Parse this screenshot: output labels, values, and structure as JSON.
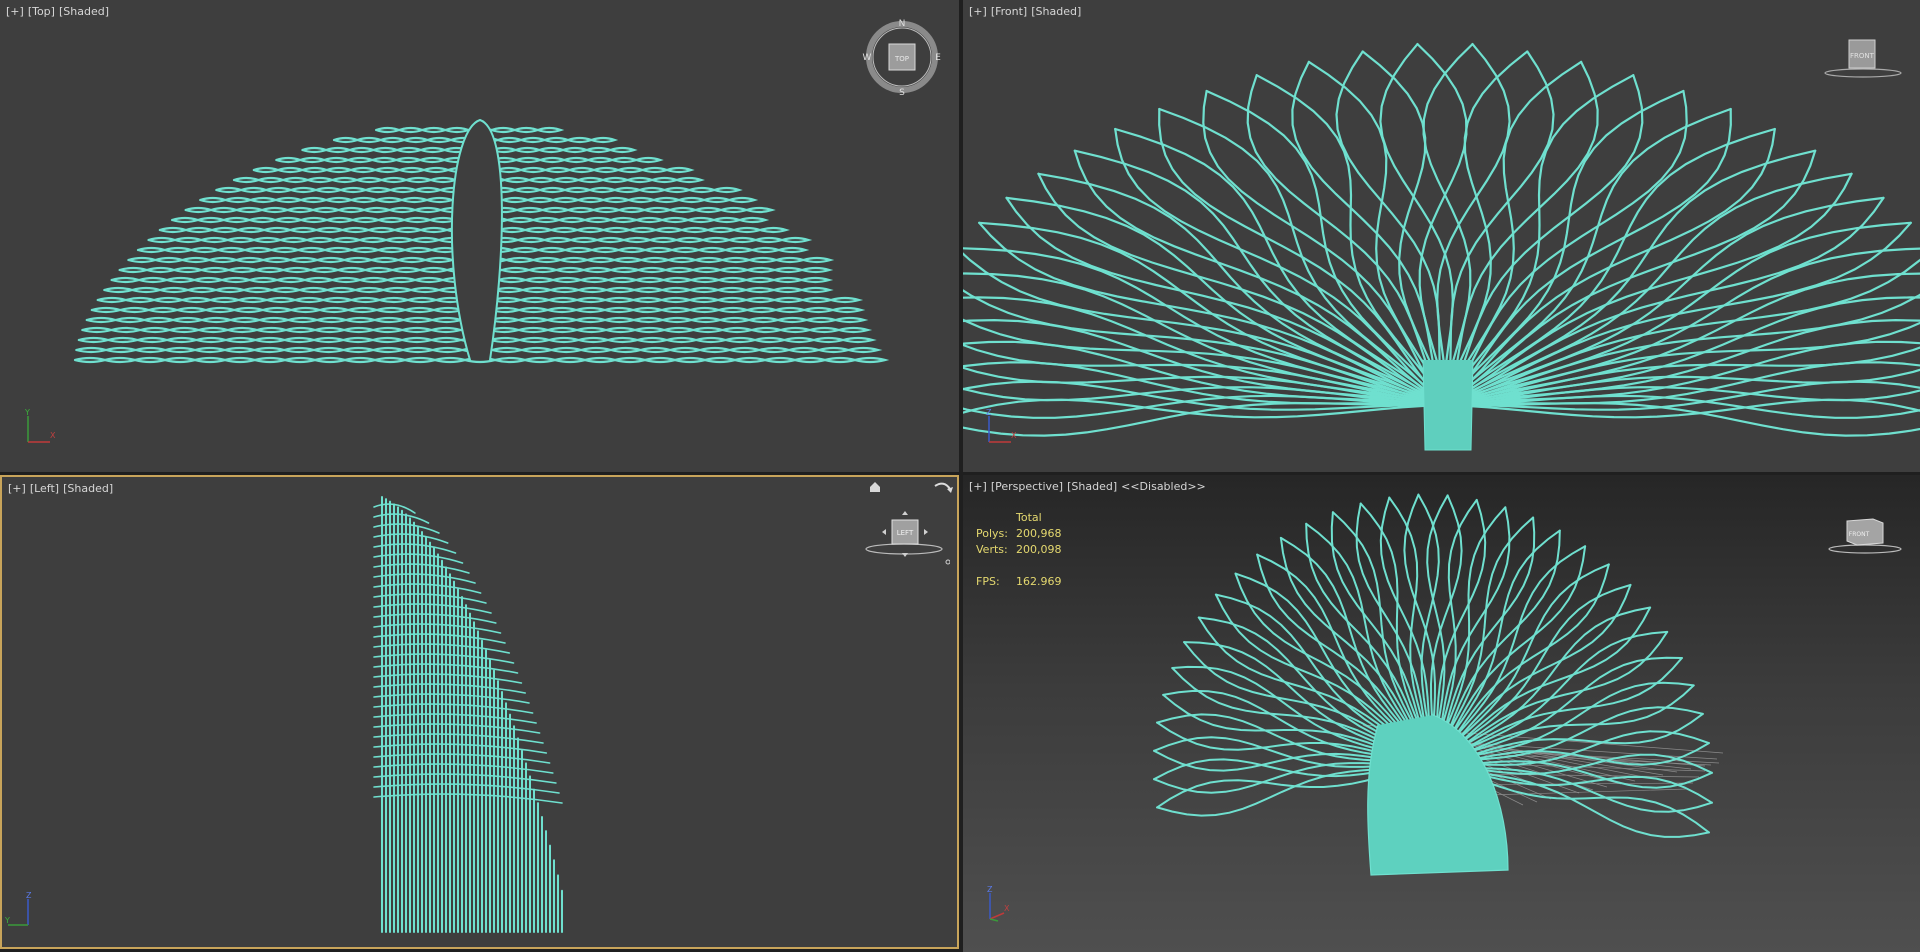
{
  "colors": {
    "mesh": "#6fe0cf",
    "viewport_bg": "#3e3e3e",
    "active_border": "#c8a45a",
    "label_text": "#d6d6d6",
    "stats_text": "#e4d86f"
  },
  "viewports": {
    "top": {
      "menu": "[+]",
      "view": "[Top]",
      "shading": "[Shaded]",
      "navcube": {
        "face": "TOP",
        "n": "N",
        "s": "S",
        "e": "E",
        "w": "W"
      },
      "axes": {
        "vertical": "Y",
        "horizontal": "X"
      }
    },
    "front": {
      "menu": "[+]",
      "view": "[Front]",
      "shading": "[Shaded]",
      "navcube": {
        "face": "FRONT"
      },
      "axes": {
        "vertical": "Z",
        "horizontal": "X"
      }
    },
    "left": {
      "menu": "[+]",
      "view": "[Left]",
      "shading": "[Shaded]",
      "active": true,
      "navcube": {
        "face": "LEFT"
      },
      "axes": {
        "vertical": "Z",
        "horizontal": "Y"
      }
    },
    "perspective": {
      "menu": "[+]",
      "view": "[Perspective]",
      "shading": "[Shaded]",
      "disabled": "<<Disabled>>",
      "navcube": {
        "face": "FRONT"
      },
      "axes": {
        "vertical": "Z",
        "horizontal": "X"
      },
      "stats": {
        "header": "Total",
        "polys_label": "Polys:",
        "polys_value": "200,968",
        "verts_label": "Verts:",
        "verts_value": "200,098",
        "fps_label": "FPS:",
        "fps_value": "162.969"
      }
    }
  }
}
